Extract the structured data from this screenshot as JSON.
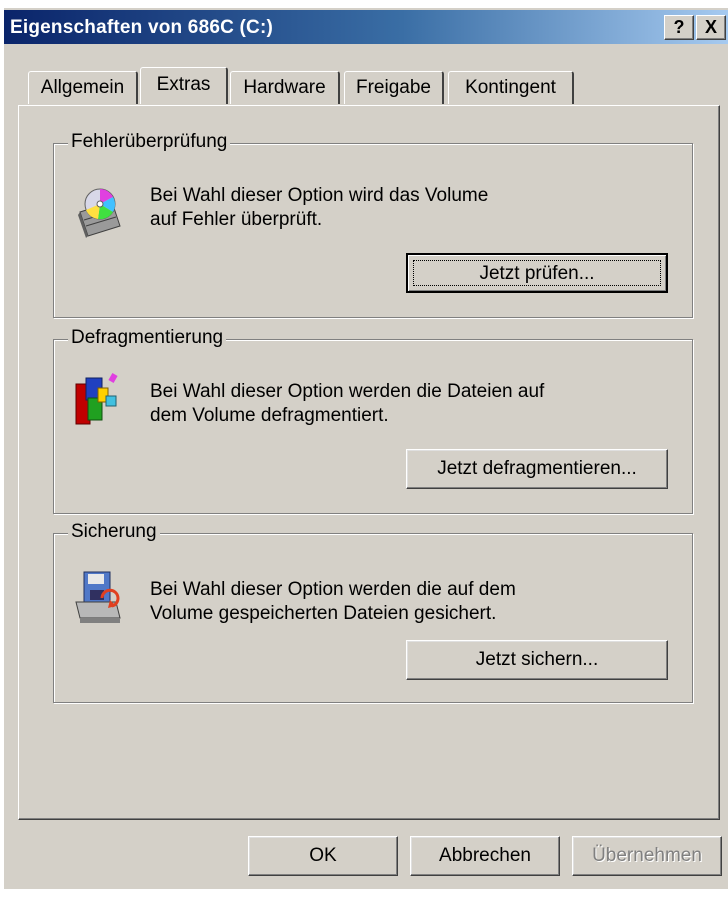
{
  "window": {
    "title": "Eigenschaften von 686C (C:)",
    "help_button": "?",
    "close_button": "X"
  },
  "tabs": [
    {
      "label": "Allgemein",
      "active": false
    },
    {
      "label": "Extras",
      "active": true
    },
    {
      "label": "Hardware",
      "active": false
    },
    {
      "label": "Freigabe",
      "active": false
    },
    {
      "label": "Kontingent",
      "active": false
    }
  ],
  "groups": {
    "check": {
      "title": "Fehlerüberprüfung",
      "line1": "Bei Wahl dieser Option wird das Volume",
      "line2": "auf Fehler überprüft.",
      "button": "Jetzt prüfen...",
      "icon": "disk-check-icon"
    },
    "defrag": {
      "title": "Defragmentierung",
      "line1": "Bei Wahl dieser Option werden die Dateien auf",
      "line2": "dem Volume defragmentiert.",
      "button": "Jetzt defragmentieren...",
      "icon": "defragment-icon"
    },
    "backup": {
      "title": "Sicherung",
      "line1": "Bei Wahl dieser Option werden die auf dem",
      "line2": "Volume gespeicherten Dateien gesichert.",
      "button": "Jetzt sichern...",
      "icon": "backup-icon"
    }
  },
  "footer": {
    "ok": "OK",
    "cancel": "Abbrechen",
    "apply": "Übernehmen"
  }
}
